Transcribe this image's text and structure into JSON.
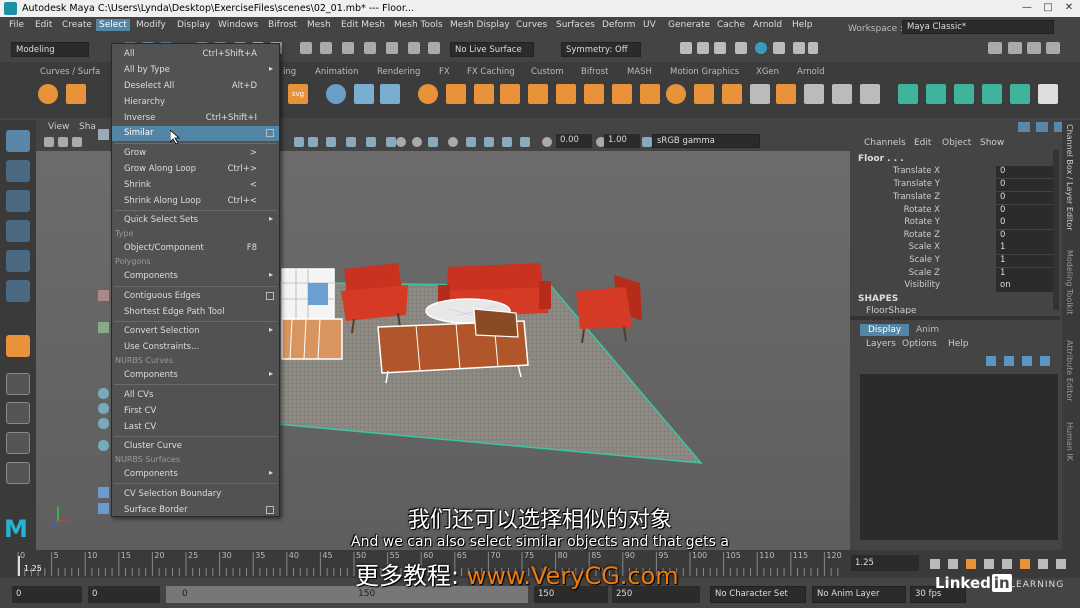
{
  "window": {
    "title": "Autodesk Maya  C:\\Users\\Lynda\\Desktop\\ExerciseFiles\\scenes\\02_01.mb*  ---  Floor...",
    "min": "—",
    "max": "□",
    "close": "✕"
  },
  "menubar": {
    "items": [
      "File",
      "Edit",
      "Create",
      "Select",
      "Modify",
      "Display",
      "Windows",
      "Bifrost",
      "Mesh",
      "Edit Mesh",
      "Mesh Tools",
      "Mesh Display",
      "Curves",
      "Surfaces",
      "Deform",
      "UV",
      "Generate",
      "Cache",
      "Arnold",
      "Help"
    ],
    "workspace_label": "Workspace :",
    "workspace_value": "Maya Classic*"
  },
  "statusline": {
    "mode": "Modeling",
    "live_surface": "No Live Surface",
    "symmetry": "Symmetry: Off"
  },
  "shelf": {
    "tabs": [
      "Curves / Surfa",
      "ing",
      "Animation",
      "Rendering",
      "FX",
      "FX Caching",
      "Custom",
      "Bifrost",
      "MASH",
      "Motion Graphics",
      "XGen",
      "Arnold"
    ]
  },
  "viewport": {
    "menu": [
      "View",
      "Sha"
    ],
    "exposure": "0.00",
    "gamma": "1.00",
    "colorspace": "sRGB gamma"
  },
  "select_menu": {
    "items": [
      {
        "label": "All",
        "shortcut": "Ctrl+Shift+A"
      },
      {
        "label": "All by Type",
        "arrow": "▸"
      },
      {
        "label": "Deselect All",
        "shortcut": "Alt+D"
      },
      {
        "label": "Hierarchy"
      },
      {
        "label": "Inverse",
        "shortcut": "Ctrl+Shift+I"
      },
      {
        "label": "Similar",
        "box": true
      },
      {
        "label": "Grow",
        "shortcut": ">"
      },
      {
        "label": "Grow Along Loop",
        "shortcut": "Ctrl+>"
      },
      {
        "label": "Shrink",
        "shortcut": "<"
      },
      {
        "label": "Shrink Along Loop",
        "shortcut": "Ctrl+<"
      },
      {
        "label": "Quick Select Sets",
        "arrow": "▸"
      },
      {
        "label": "Object/Component",
        "shortcut": "F8"
      },
      {
        "label": "Components",
        "arrow": "▸"
      },
      {
        "label": "Contiguous Edges",
        "box": true
      },
      {
        "label": "Shortest Edge Path Tool"
      },
      {
        "label": "Convert Selection",
        "arrow": "▸"
      },
      {
        "label": "Use Constraints..."
      },
      {
        "label": "Components",
        "arrow": "▸"
      },
      {
        "label": "All CVs"
      },
      {
        "label": "First CV"
      },
      {
        "label": "Last CV"
      },
      {
        "label": "Cluster Curve"
      },
      {
        "label": "Components",
        "arrow": "▸"
      },
      {
        "label": "CV Selection Boundary"
      },
      {
        "label": "Surface Border",
        "box": true
      }
    ],
    "sections": [
      "Type",
      "Polygons",
      "NURBS Curves",
      "NURBS Surfaces"
    ]
  },
  "channelbox": {
    "menus": [
      "Channels",
      "Edit",
      "Object",
      "Show"
    ],
    "object": "Floor . . .",
    "attrs": [
      {
        "name": "Translate X",
        "value": "0"
      },
      {
        "name": "Translate Y",
        "value": "0"
      },
      {
        "name": "Translate Z",
        "value": "0"
      },
      {
        "name": "Rotate X",
        "value": "0"
      },
      {
        "name": "Rotate Y",
        "value": "0"
      },
      {
        "name": "Rotate Z",
        "value": "0"
      },
      {
        "name": "Scale X",
        "value": "1"
      },
      {
        "name": "Scale Y",
        "value": "1"
      },
      {
        "name": "Scale Z",
        "value": "1"
      },
      {
        "name": "Visibility",
        "value": "on"
      }
    ],
    "shapes_label": "SHAPES",
    "shape_name": "FloorShape",
    "side_tabs": [
      "Channel Box / Layer Editor",
      "Modeling Toolkit",
      "Attribute Editor",
      "Human IK"
    ]
  },
  "layer_editor": {
    "tabs": [
      "Display",
      "Anim"
    ],
    "menus": [
      "Layers",
      "Options",
      "Help"
    ]
  },
  "timeline": {
    "ticks": [
      "0",
      "5",
      "10",
      "15",
      "20",
      "25",
      "30",
      "35",
      "40",
      "45",
      "50",
      "55",
      "60",
      "65",
      "70",
      "75",
      "80",
      "85",
      "90",
      "95",
      "100",
      "105",
      "110",
      "115",
      "120"
    ],
    "current": "1.25",
    "current_field": "1.25"
  },
  "range": {
    "start": "0",
    "start2": "0",
    "slider_start": "0",
    "slider_end": "150",
    "end1": "150",
    "end2": "250",
    "character_set": "No Character Set",
    "anim_layer": "No Anim Layer",
    "fps": "30 fps"
  },
  "subtitles": {
    "chinese": "我们还可以选择相似的对象",
    "english": "And we can also select similar objects and that gets a",
    "watermark_prefix": "更多教程:",
    "watermark_url": "www.VeryCG.com"
  },
  "branding": {
    "linkedin": "Linked",
    "linkedin_in": "in",
    "learning": "LEARNING"
  }
}
